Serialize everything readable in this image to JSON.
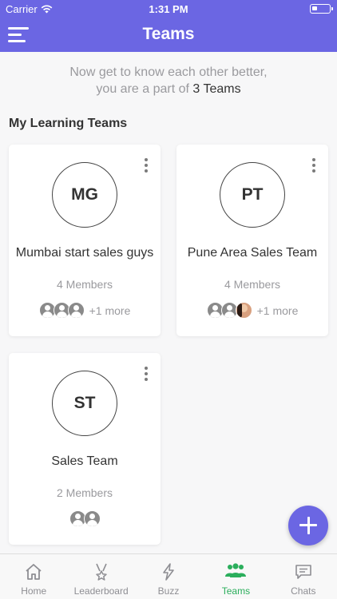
{
  "status_bar": {
    "carrier": "Carrier",
    "time": "1:31 PM"
  },
  "header": {
    "title": "Teams",
    "menu_icon": "menu-icon"
  },
  "intro": {
    "line1": "Now get to know each other better,",
    "line2_prefix": "you are a part of ",
    "team_count": "3 Teams"
  },
  "section": {
    "title": "My Learning Teams"
  },
  "teams": [
    {
      "initials": "MG",
      "name": "Mumbai start sales guys",
      "members": "4 Members",
      "more": "+1 more"
    },
    {
      "initials": "PT",
      "name": "Pune Area Sales Team",
      "members": "4 Members",
      "more": "+1 more"
    },
    {
      "initials": "ST",
      "name": "Sales Team",
      "members": "2 Members",
      "more": ""
    }
  ],
  "fab": {
    "icon": "plus-icon"
  },
  "tabs": [
    {
      "label": "Home",
      "icon": "home-icon",
      "active": false
    },
    {
      "label": "Leaderboard",
      "icon": "medal-icon",
      "active": false
    },
    {
      "label": "Buzz",
      "icon": "lightning-icon",
      "active": false
    },
    {
      "label": "Teams",
      "icon": "group-icon",
      "active": true
    },
    {
      "label": "Chats",
      "icon": "chat-icon",
      "active": false
    }
  ],
  "colors": {
    "primary": "#6b66e3",
    "active_tab": "#2bae5c",
    "muted_text": "#9a9a9e"
  }
}
